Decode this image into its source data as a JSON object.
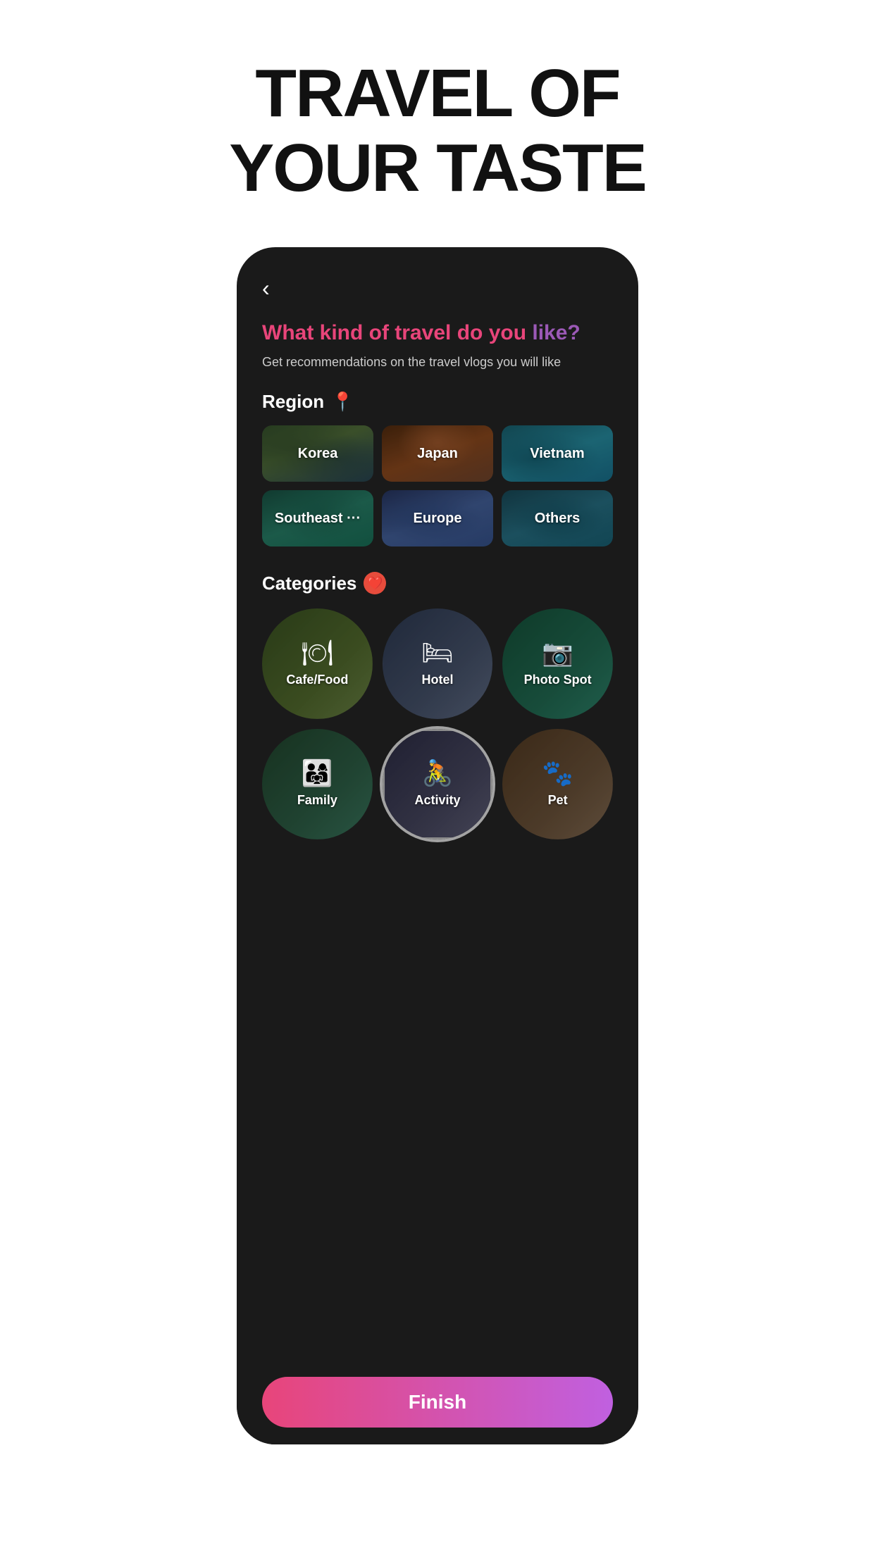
{
  "page": {
    "title_line1": "TRAVEL OF",
    "title_line2": "YOUR TASTE"
  },
  "phone": {
    "back_label": "‹",
    "question": {
      "part1": "What kind of travel do ",
      "part2": "you",
      "part3": " like?",
      "subtitle": "Get recommendations on the travel vlogs you will like"
    },
    "region_section": {
      "label": "Region"
    },
    "region_cards": [
      {
        "id": "korea",
        "label": "Korea"
      },
      {
        "id": "japan",
        "label": "Japan"
      },
      {
        "id": "vietnam",
        "label": "Vietnam"
      },
      {
        "id": "southeast",
        "label": "Southeast ···"
      },
      {
        "id": "europe",
        "label": "Europe"
      },
      {
        "id": "others",
        "label": "Others"
      }
    ],
    "categories_section": {
      "label": "Categories"
    },
    "category_items": [
      {
        "id": "cafe",
        "label": "Cafe/Food",
        "icon": "🍽"
      },
      {
        "id": "hotel",
        "label": "Hotel",
        "icon": "🛏"
      },
      {
        "id": "photospot",
        "label": "Photo Spot",
        "icon": "📷"
      },
      {
        "id": "family",
        "label": "Family",
        "icon": "👨‍👩‍👧"
      },
      {
        "id": "activity",
        "label": "Activity",
        "icon": "🚴"
      },
      {
        "id": "pet",
        "label": "Pet",
        "icon": "🐾"
      }
    ],
    "finish_button": {
      "label": "Finish"
    }
  }
}
